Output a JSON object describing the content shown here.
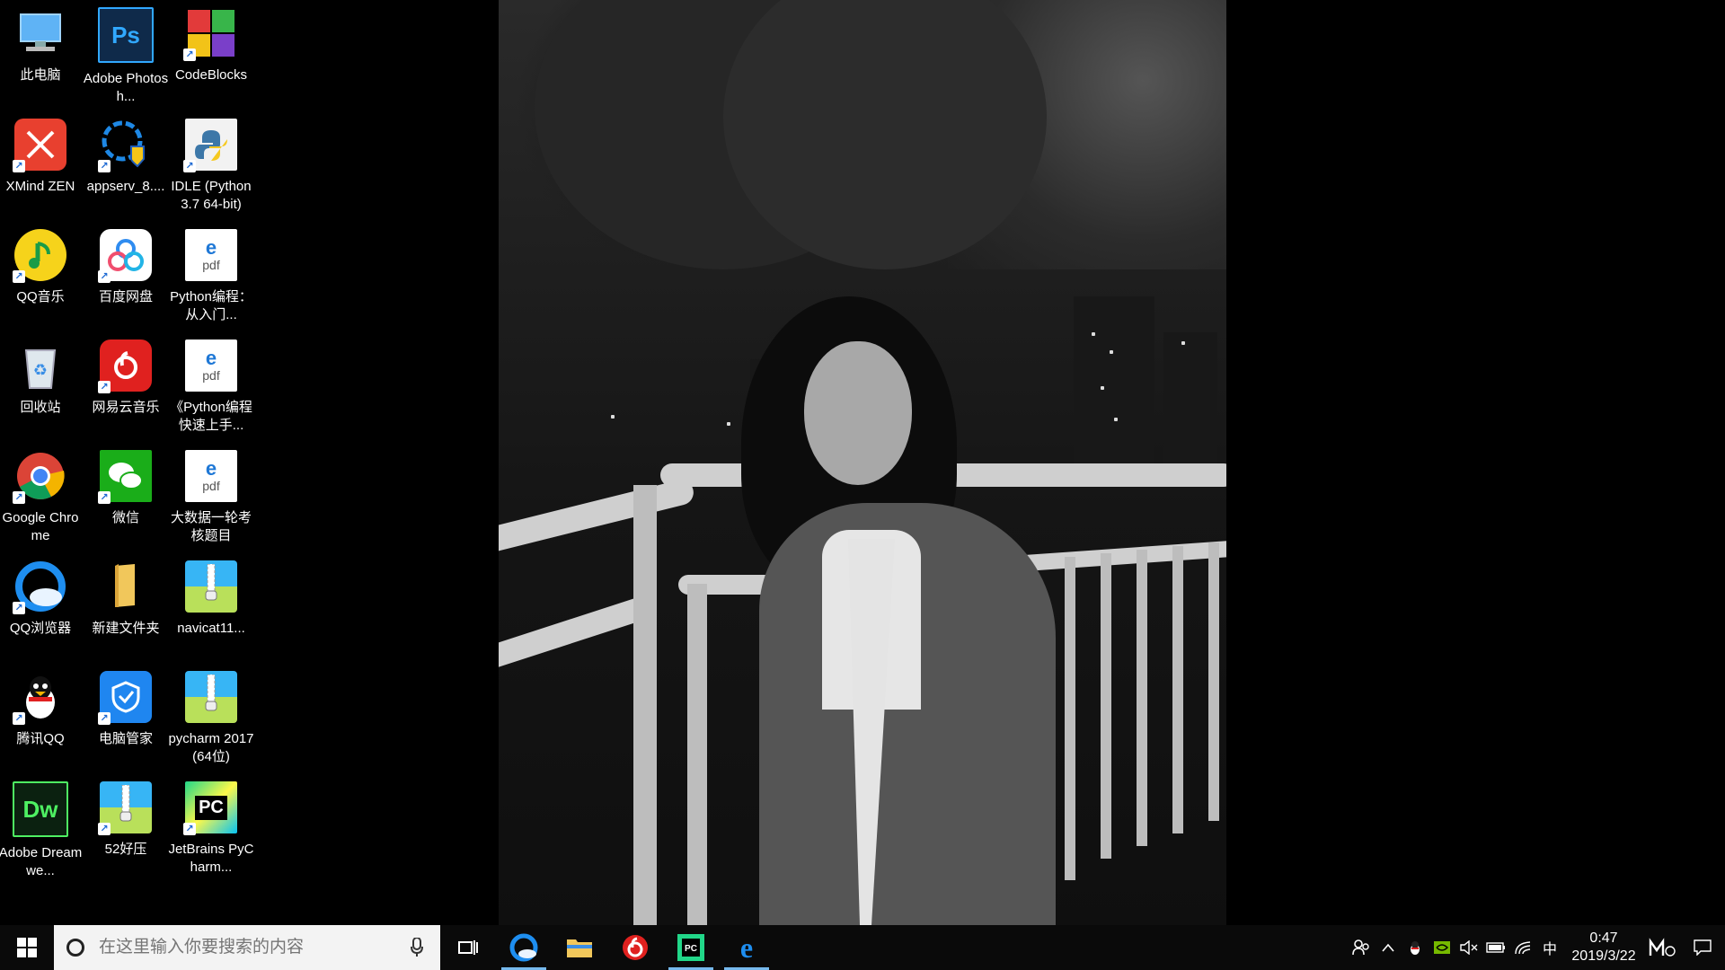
{
  "desktop": {
    "icons": [
      {
        "label": "此电脑",
        "icon": "this-pc-icon"
      },
      {
        "label": "Adobe Photosh...",
        "icon": "photoshop-icon",
        "glyph": "Ps"
      },
      {
        "label": "CodeBlocks",
        "icon": "codeblocks-icon"
      },
      {
        "label": "XMind ZEN",
        "icon": "xmind-icon"
      },
      {
        "label": "appserv_8....",
        "icon": "appserv-icon"
      },
      {
        "label": "IDLE (Python 3.7 64-bit)",
        "icon": "python-idle-icon"
      },
      {
        "label": "QQ音乐",
        "icon": "qq-music-icon"
      },
      {
        "label": "百度网盘",
        "icon": "baidu-netdisk-icon"
      },
      {
        "label": "Python编程：从入门...",
        "icon": "pdf-file-icon",
        "glyph": "pdf"
      },
      {
        "label": "回收站",
        "icon": "recycle-bin-icon"
      },
      {
        "label": "网易云音乐",
        "icon": "netease-music-icon"
      },
      {
        "label": "《Python编程快速上手...",
        "icon": "pdf-file-icon",
        "glyph": "pdf"
      },
      {
        "label": "Google Chrome",
        "icon": "chrome-icon"
      },
      {
        "label": "微信",
        "icon": "wechat-icon"
      },
      {
        "label": "大数据一轮考核题目",
        "icon": "pdf-file-icon",
        "glyph": "pdf"
      },
      {
        "label": "QQ浏览器",
        "icon": "qq-browser-icon"
      },
      {
        "label": "新建文件夹",
        "icon": "folder-icon"
      },
      {
        "label": "navicat11...",
        "icon": "zip-archive-icon"
      },
      {
        "label": "腾讯QQ",
        "icon": "qq-penguin-icon"
      },
      {
        "label": "电脑管家",
        "icon": "pc-manager-icon"
      },
      {
        "label": "pycharm 2017(64位)",
        "icon": "zip-archive-icon"
      },
      {
        "label": "Adobe Dreamwe...",
        "icon": "dreamweaver-icon",
        "glyph": "Dw"
      },
      {
        "label": "52好压",
        "icon": "zip-archive-icon"
      },
      {
        "label": "JetBrains PyCharm...",
        "icon": "pycharm-icon",
        "glyph": "PC"
      }
    ]
  },
  "taskbar": {
    "search_placeholder": "在这里输入你要搜索的内容",
    "pinned": [
      "qq-browser-icon",
      "file-explorer-icon",
      "netease-music-icon",
      "pycharm-icon",
      "edge-icon"
    ],
    "tray": {
      "ime": "中",
      "time": "0:47",
      "date": "2019/3/22"
    }
  },
  "colors": {
    "taskbar_bg": "#0a0a0a",
    "search_bg": "#f3f3f3",
    "accent": "#76b9ed"
  }
}
